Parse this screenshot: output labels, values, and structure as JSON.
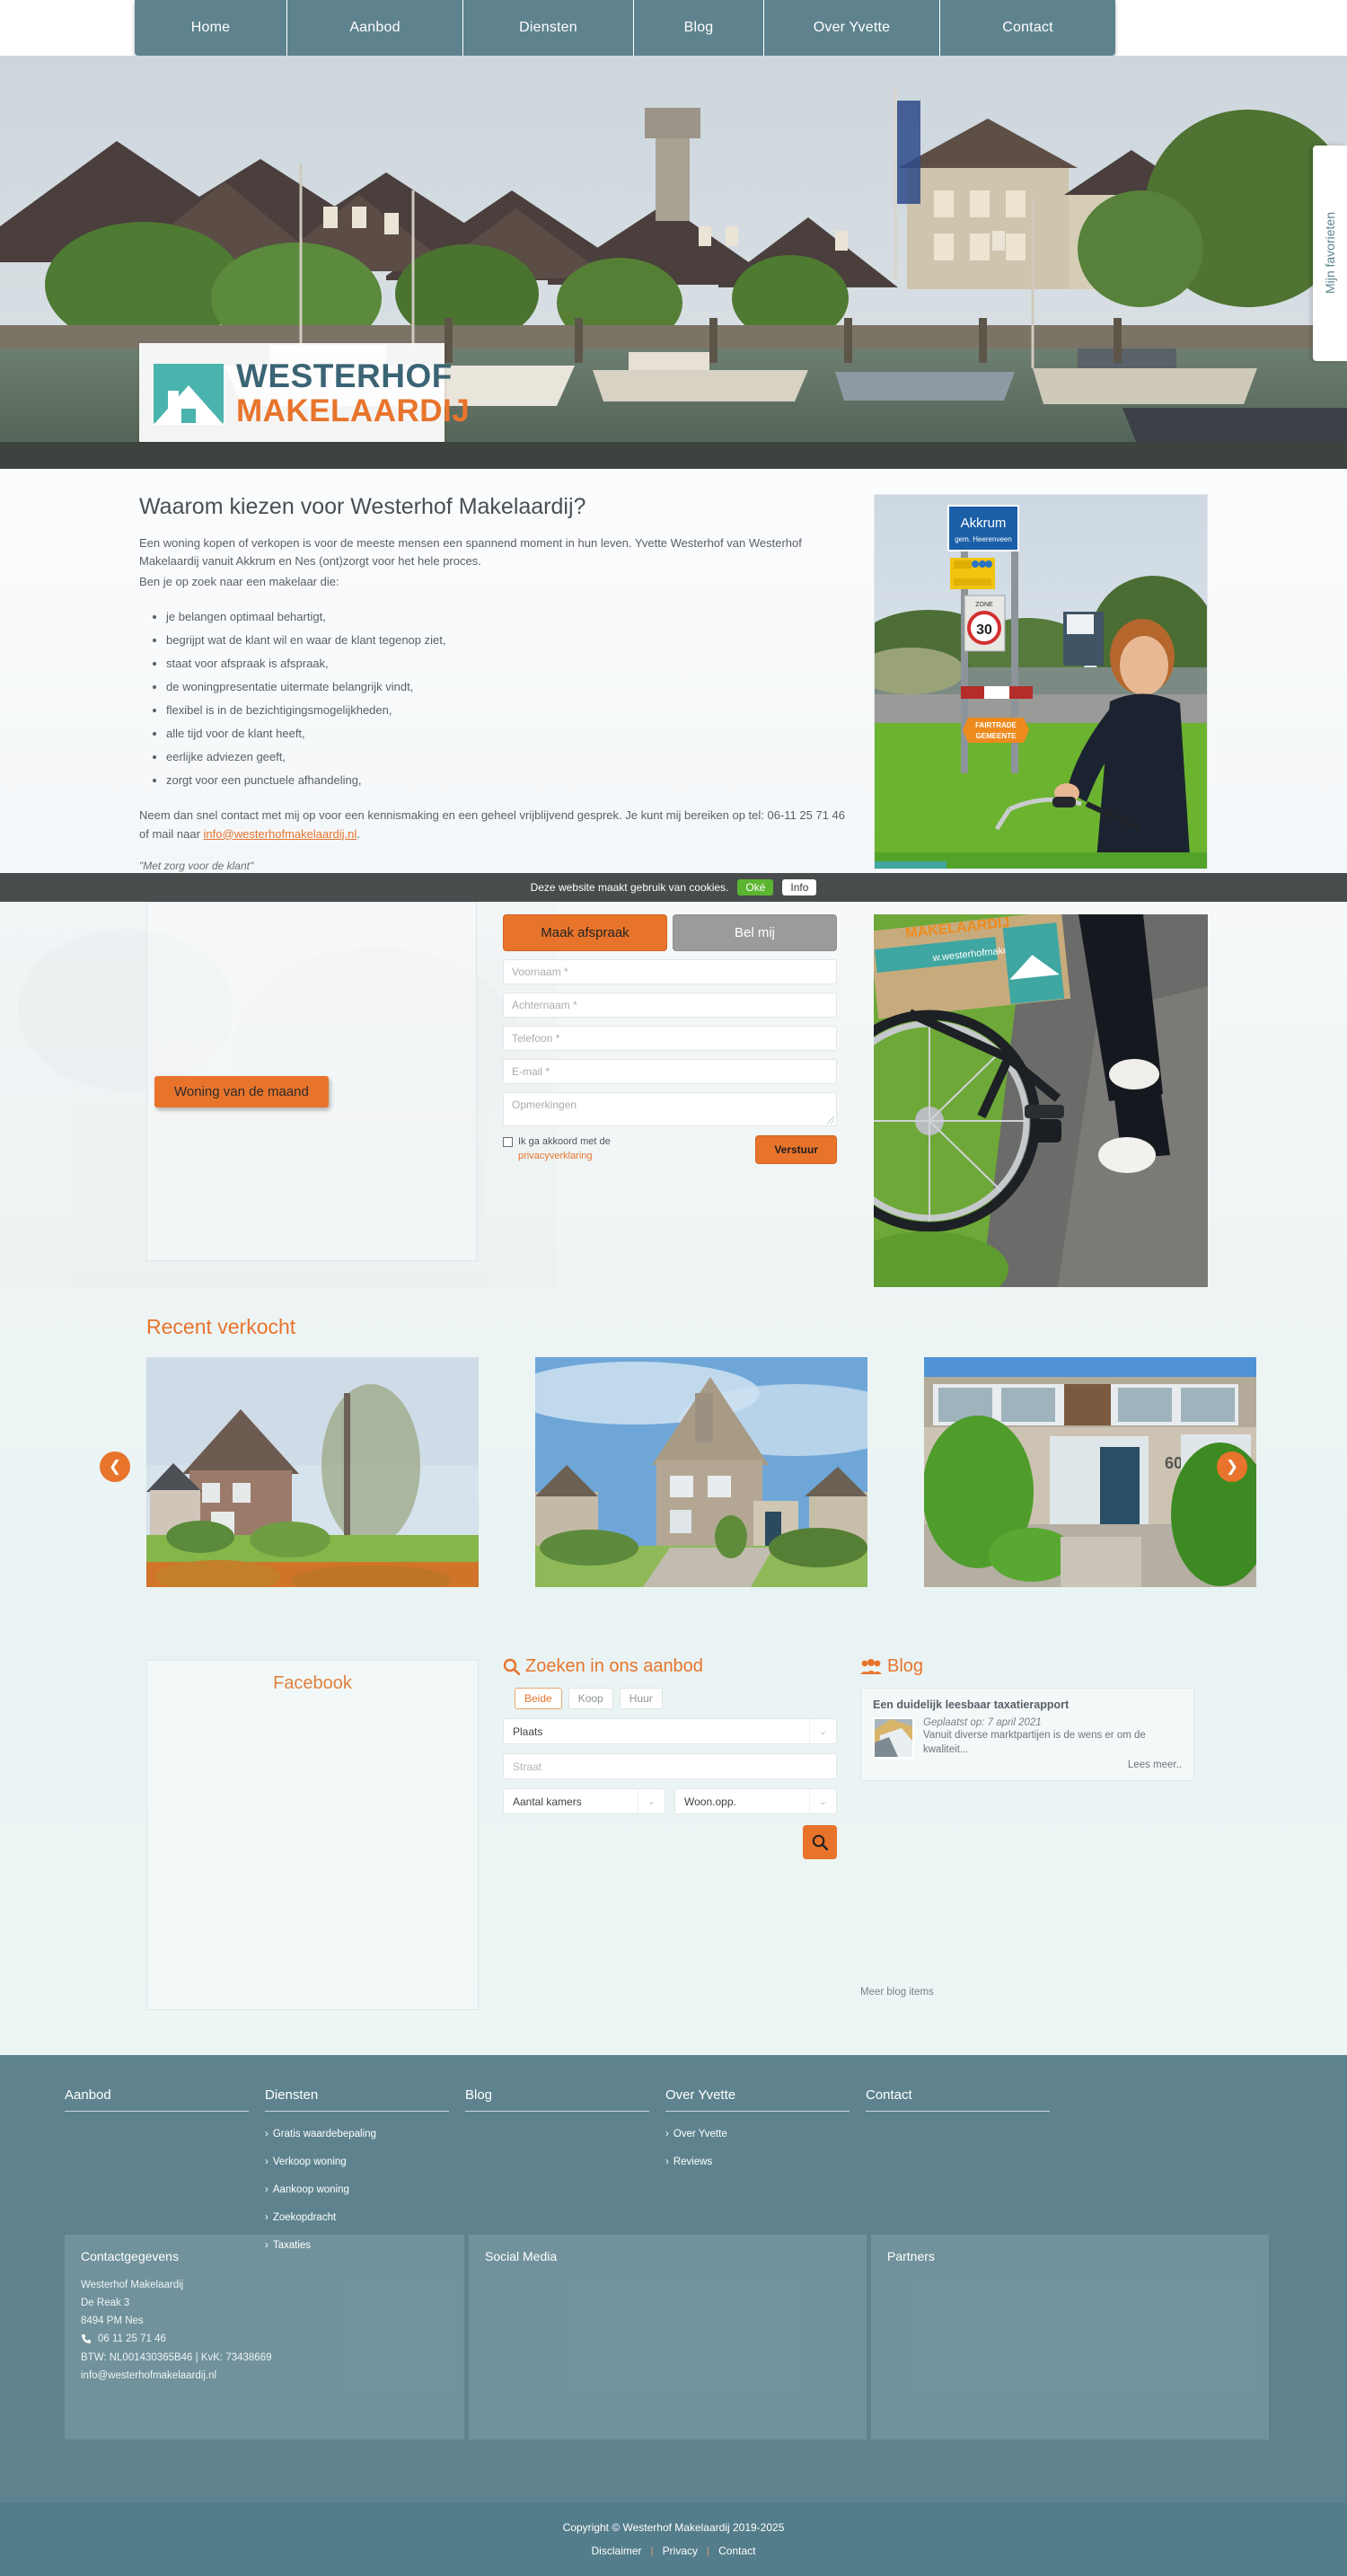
{
  "brand": {
    "name_top": "WESTERHOF",
    "name_bottom": "MAKELAARDIJ",
    "accent": "#e8742c",
    "teal": "#4bb3ad",
    "slate": "#5e838f"
  },
  "nav": {
    "items": [
      {
        "label": "Home",
        "width": 170
      },
      {
        "label": "Aanbod",
        "width": 196
      },
      {
        "label": "Diensten",
        "width": 190
      },
      {
        "label": "Blog",
        "width": 145
      },
      {
        "label": "Over Yvette",
        "width": 196
      },
      {
        "label": "Contact",
        "width": 195
      }
    ]
  },
  "favorites_tab": {
    "label": "Mijn favorieten"
  },
  "intro": {
    "heading": "Waarom kiezen voor Westerhof Makelaardij?",
    "para1": "Een woning kopen of verkopen is voor de meeste mensen een spannend moment in hun leven. Yvette Westerhof van Westerhof Makelaardij vanuit Akkrum en Nes (ont)zorgt voor het hele proces.",
    "para2": "Ben je op zoek naar een makelaar die:",
    "bullets": [
      "je belangen optimaal behartigt,",
      "begrijpt wat de klant wil en waar de klant tegenop ziet,",
      "staat voor afspraak is afspraak,",
      "de woningpresentatie uitermate belangrijk vindt,",
      "flexibel is in de bezichtigingsmogelijkheden,",
      "alle tijd voor de klant heeft,",
      "eerlijke adviezen geeft,",
      "zorgt voor een punctuele afhandeling,"
    ],
    "closing_pre": "Neem dan snel contact met mij op voor een kennismaking en een geheel vrijblijvend gesprek. Je kunt mij bereiken op tel: 06-11 25 71 46 of mail naar ",
    "closing_link": "info@westerhofmakelaardij.nl",
    "closing_post": ".",
    "quote": "\"Met zorg voor de klant\""
  },
  "cookiebar": {
    "text": "Deze website maakt gebruik van cookies.",
    "accept_label": "Oké",
    "info_label": "Info"
  },
  "woning": {
    "badge_label": "Woning van de maand"
  },
  "contact_form": {
    "tab_appointment": "Maak afspraak",
    "tab_call": "Bel mij",
    "fields": [
      {
        "placeholder": "Voornaam *",
        "value": ""
      },
      {
        "placeholder": "Achternaam *",
        "value": ""
      },
      {
        "placeholder": "Telefoon *",
        "value": ""
      },
      {
        "placeholder": "E-mail *",
        "value": ""
      }
    ],
    "textarea_placeholder": "Opmerkingen",
    "consent_text": "Ik ga akkoord met de",
    "consent_link": "privacyverklaring",
    "submit_label": "Verstuur"
  },
  "recent": {
    "heading": "Recent verkocht",
    "prev_icon": "chevron-left",
    "next_icon": "chevron-right"
  },
  "facebook": {
    "title": "Facebook"
  },
  "search": {
    "heading": "Zoeken in ons aanbod",
    "types": [
      {
        "label": "Beide",
        "active": true
      },
      {
        "label": "Koop",
        "active": false
      },
      {
        "label": "Huur",
        "active": false
      }
    ],
    "plaats": "Plaats",
    "straat_placeholder": "Straat",
    "kamers": "Aantal kamers",
    "woonopp": "Woon.opp."
  },
  "blog": {
    "heading": "Blog",
    "post": {
      "title": "Een duidelijk leesbaar taxatierapport",
      "date": "Geplaatst op: 7 april 2021",
      "excerpt": "Vanuit diverse marktpartijen is de wens er om de kwaliteit...",
      "read_more": "Lees meer.."
    },
    "more_label": "Meer blog items"
  },
  "footer": {
    "columns": [
      {
        "title": "Aanbod",
        "links": []
      },
      {
        "title": "Diensten",
        "links": [
          "Gratis waardebepaling",
          "Verkoop woning",
          "Aankoop woning",
          "Zoekopdracht",
          "Taxaties"
        ]
      },
      {
        "title": "Blog",
        "links": []
      },
      {
        "title": "Over Yvette",
        "links": [
          "Over Yvette",
          "Reviews"
        ]
      },
      {
        "title": "Contact",
        "links": []
      }
    ],
    "contact_panel": {
      "title": "Contactgegevens",
      "company": "Westerhof Makelaardij",
      "street": "De Reak 3",
      "city": "8494 PM Nes",
      "phone": "06 11 25 71 46",
      "registration": "BTW: NL001430365B46 | KvK: 73438669",
      "email": "info@westerhofmakelaardij.nl"
    },
    "social_panel": {
      "title": "Social Media"
    },
    "partners_panel": {
      "title": "Partners"
    }
  },
  "copyright": {
    "text": "Copyright © Westerhof Makelaardij 2019-2025",
    "links": [
      "Disclaimer",
      "Privacy",
      "Contact"
    ]
  }
}
